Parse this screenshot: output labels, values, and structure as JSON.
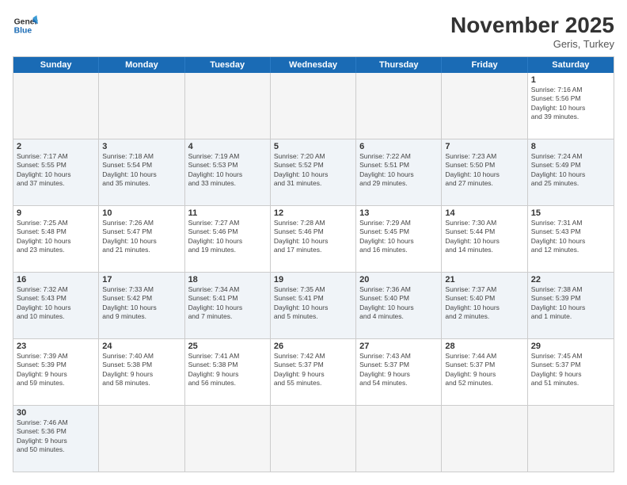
{
  "header": {
    "logo_general": "General",
    "logo_blue": "Blue",
    "title": "November 2025",
    "location": "Geris, Turkey"
  },
  "days": [
    "Sunday",
    "Monday",
    "Tuesday",
    "Wednesday",
    "Thursday",
    "Friday",
    "Saturday"
  ],
  "rows": [
    [
      {
        "day": "",
        "info": "",
        "empty": true
      },
      {
        "day": "",
        "info": "",
        "empty": true
      },
      {
        "day": "",
        "info": "",
        "empty": true
      },
      {
        "day": "",
        "info": "",
        "empty": true
      },
      {
        "day": "",
        "info": "",
        "empty": true
      },
      {
        "day": "",
        "info": "",
        "empty": true
      },
      {
        "day": "1",
        "info": "Sunrise: 7:16 AM\nSunset: 5:56 PM\nDaylight: 10 hours\nand 39 minutes."
      }
    ],
    [
      {
        "day": "2",
        "info": "Sunrise: 7:17 AM\nSunset: 5:55 PM\nDaylight: 10 hours\nand 37 minutes."
      },
      {
        "day": "3",
        "info": "Sunrise: 7:18 AM\nSunset: 5:54 PM\nDaylight: 10 hours\nand 35 minutes."
      },
      {
        "day": "4",
        "info": "Sunrise: 7:19 AM\nSunset: 5:53 PM\nDaylight: 10 hours\nand 33 minutes."
      },
      {
        "day": "5",
        "info": "Sunrise: 7:20 AM\nSunset: 5:52 PM\nDaylight: 10 hours\nand 31 minutes."
      },
      {
        "day": "6",
        "info": "Sunrise: 7:22 AM\nSunset: 5:51 PM\nDaylight: 10 hours\nand 29 minutes."
      },
      {
        "day": "7",
        "info": "Sunrise: 7:23 AM\nSunset: 5:50 PM\nDaylight: 10 hours\nand 27 minutes."
      },
      {
        "day": "8",
        "info": "Sunrise: 7:24 AM\nSunset: 5:49 PM\nDaylight: 10 hours\nand 25 minutes."
      }
    ],
    [
      {
        "day": "9",
        "info": "Sunrise: 7:25 AM\nSunset: 5:48 PM\nDaylight: 10 hours\nand 23 minutes."
      },
      {
        "day": "10",
        "info": "Sunrise: 7:26 AM\nSunset: 5:47 PM\nDaylight: 10 hours\nand 21 minutes."
      },
      {
        "day": "11",
        "info": "Sunrise: 7:27 AM\nSunset: 5:46 PM\nDaylight: 10 hours\nand 19 minutes."
      },
      {
        "day": "12",
        "info": "Sunrise: 7:28 AM\nSunset: 5:46 PM\nDaylight: 10 hours\nand 17 minutes."
      },
      {
        "day": "13",
        "info": "Sunrise: 7:29 AM\nSunset: 5:45 PM\nDaylight: 10 hours\nand 16 minutes."
      },
      {
        "day": "14",
        "info": "Sunrise: 7:30 AM\nSunset: 5:44 PM\nDaylight: 10 hours\nand 14 minutes."
      },
      {
        "day": "15",
        "info": "Sunrise: 7:31 AM\nSunset: 5:43 PM\nDaylight: 10 hours\nand 12 minutes."
      }
    ],
    [
      {
        "day": "16",
        "info": "Sunrise: 7:32 AM\nSunset: 5:43 PM\nDaylight: 10 hours\nand 10 minutes."
      },
      {
        "day": "17",
        "info": "Sunrise: 7:33 AM\nSunset: 5:42 PM\nDaylight: 10 hours\nand 9 minutes."
      },
      {
        "day": "18",
        "info": "Sunrise: 7:34 AM\nSunset: 5:41 PM\nDaylight: 10 hours\nand 7 minutes."
      },
      {
        "day": "19",
        "info": "Sunrise: 7:35 AM\nSunset: 5:41 PM\nDaylight: 10 hours\nand 5 minutes."
      },
      {
        "day": "20",
        "info": "Sunrise: 7:36 AM\nSunset: 5:40 PM\nDaylight: 10 hours\nand 4 minutes."
      },
      {
        "day": "21",
        "info": "Sunrise: 7:37 AM\nSunset: 5:40 PM\nDaylight: 10 hours\nand 2 minutes."
      },
      {
        "day": "22",
        "info": "Sunrise: 7:38 AM\nSunset: 5:39 PM\nDaylight: 10 hours\nand 1 minute."
      }
    ],
    [
      {
        "day": "23",
        "info": "Sunrise: 7:39 AM\nSunset: 5:39 PM\nDaylight: 9 hours\nand 59 minutes."
      },
      {
        "day": "24",
        "info": "Sunrise: 7:40 AM\nSunset: 5:38 PM\nDaylight: 9 hours\nand 58 minutes."
      },
      {
        "day": "25",
        "info": "Sunrise: 7:41 AM\nSunset: 5:38 PM\nDaylight: 9 hours\nand 56 minutes."
      },
      {
        "day": "26",
        "info": "Sunrise: 7:42 AM\nSunset: 5:37 PM\nDaylight: 9 hours\nand 55 minutes."
      },
      {
        "day": "27",
        "info": "Sunrise: 7:43 AM\nSunset: 5:37 PM\nDaylight: 9 hours\nand 54 minutes."
      },
      {
        "day": "28",
        "info": "Sunrise: 7:44 AM\nSunset: 5:37 PM\nDaylight: 9 hours\nand 52 minutes."
      },
      {
        "day": "29",
        "info": "Sunrise: 7:45 AM\nSunset: 5:37 PM\nDaylight: 9 hours\nand 51 minutes."
      }
    ],
    [
      {
        "day": "30",
        "info": "Sunrise: 7:46 AM\nSunset: 5:36 PM\nDaylight: 9 hours\nand 50 minutes."
      },
      {
        "day": "",
        "info": "",
        "empty": true
      },
      {
        "day": "",
        "info": "",
        "empty": true
      },
      {
        "day": "",
        "info": "",
        "empty": true
      },
      {
        "day": "",
        "info": "",
        "empty": true
      },
      {
        "day": "",
        "info": "",
        "empty": true
      },
      {
        "day": "",
        "info": "",
        "empty": true
      }
    ]
  ]
}
